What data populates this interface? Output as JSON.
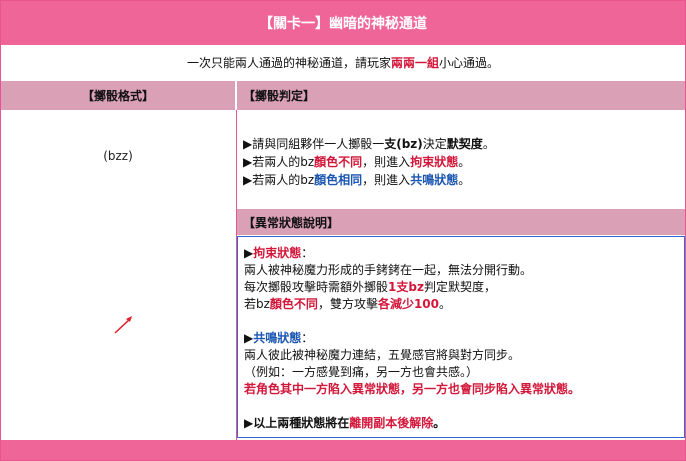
{
  "title": "【關卡一】幽暗的神秘通道",
  "subtitle": {
    "pre": "一次只能兩人通過的神秘通道，請玩家",
    "highlight": "兩兩一組",
    "post": "小心通過。"
  },
  "columns": {
    "left_header": "【擲骰格式】",
    "right_header": "【擲骰判定】"
  },
  "format_text": "(bzz)",
  "rules": [
    {
      "parts": [
        {
          "t": "▶請與同組夥伴一人擲骰一",
          "c": ""
        },
        {
          "t": "支(bz)",
          "c": "b"
        },
        {
          "t": "決定",
          "c": ""
        },
        {
          "t": "默契度",
          "c": "b"
        },
        {
          "t": "。",
          "c": ""
        }
      ]
    },
    {
      "parts": [
        {
          "t": "▶若兩人的bz",
          "c": ""
        },
        {
          "t": "顏色不同",
          "c": "red"
        },
        {
          "t": "，則進入",
          "c": ""
        },
        {
          "t": "拘束狀態",
          "c": "red"
        },
        {
          "t": "。",
          "c": ""
        }
      ]
    },
    {
      "parts": [
        {
          "t": "▶若兩人的bz",
          "c": ""
        },
        {
          "t": "顏色相同",
          "c": "blue"
        },
        {
          "t": "，則進入",
          "c": ""
        },
        {
          "t": "共鳴狀態",
          "c": "blue"
        },
        {
          "t": "。",
          "c": ""
        }
      ]
    }
  ],
  "abnormal": {
    "header": "【異常狀態說明】",
    "lines": [
      {
        "parts": [
          {
            "t": "▶",
            "c": "b"
          },
          {
            "t": "拘束狀態",
            "c": "red"
          },
          {
            "t": "：",
            "c": ""
          }
        ]
      },
      {
        "parts": [
          {
            "t": "兩人被神秘魔力形成的手銬銬在一起，無法分開行動。",
            "c": ""
          }
        ]
      },
      {
        "parts": [
          {
            "t": "每次擲骰攻擊時需額外擲骰",
            "c": ""
          },
          {
            "t": "1支bz",
            "c": "red"
          },
          {
            "t": "判定默契度，",
            "c": ""
          }
        ]
      },
      {
        "parts": [
          {
            "t": "若bz",
            "c": ""
          },
          {
            "t": "顏色不同",
            "c": "red"
          },
          {
            "t": "，雙方攻擊",
            "c": ""
          },
          {
            "t": "各減少100",
            "c": "red"
          },
          {
            "t": "。",
            "c": ""
          }
        ]
      },
      {
        "gap": true
      },
      {
        "parts": [
          {
            "t": "▶",
            "c": "b"
          },
          {
            "t": "共鳴狀態",
            "c": "blue"
          },
          {
            "t": "：",
            "c": ""
          }
        ]
      },
      {
        "parts": [
          {
            "t": "兩人彼此被神秘魔力連結，五覺感官將與對方同步。",
            "c": ""
          }
        ]
      },
      {
        "parts": [
          {
            "t": "（例如：一方感覺到痛，另一方也會共感。）",
            "c": ""
          }
        ]
      },
      {
        "parts": [
          {
            "t": "若角色其中一方陷入異常狀態，另一方也會同步陷入異常狀態。",
            "c": "red"
          }
        ]
      },
      {
        "gap": true
      },
      {
        "parts": [
          {
            "t": "▶以上兩種狀態將在",
            "c": "b"
          },
          {
            "t": "離開副本後解除",
            "c": "red"
          },
          {
            "t": "。",
            "c": "b"
          }
        ]
      }
    ]
  },
  "colors": {
    "pink": "#f06597",
    "mauve": "#d9a0b6",
    "red": "#d3173a",
    "blue": "#1b56b0"
  }
}
